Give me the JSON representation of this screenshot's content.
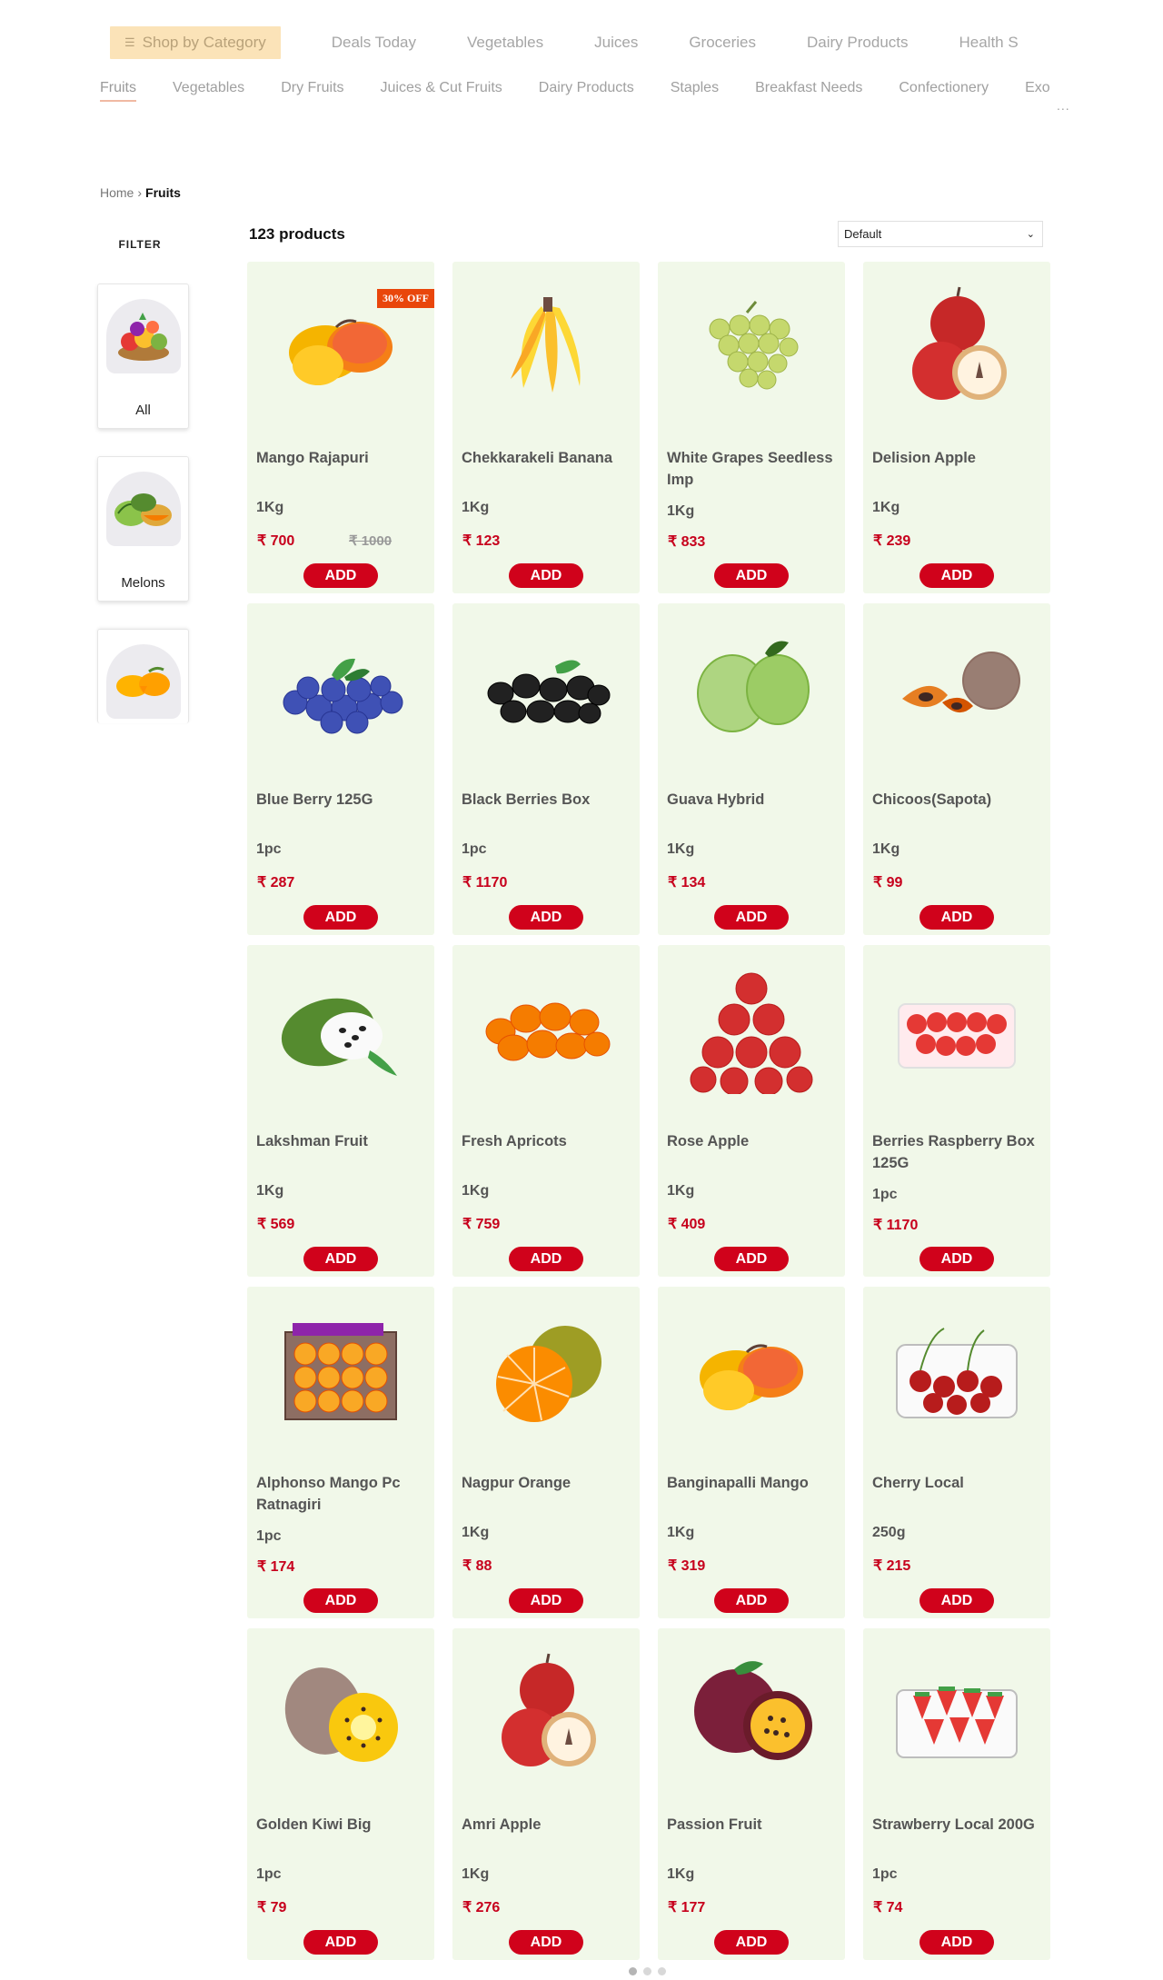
{
  "topnav": {
    "shop_label": "Shop by Category",
    "links": [
      "Deals Today",
      "Vegetables",
      "Juices",
      "Groceries",
      "Dairy Products",
      "Health S"
    ]
  },
  "subnav": {
    "links": [
      "Fruits",
      "Vegetables",
      "Dry Fruits",
      "Juices & Cut Fruits",
      "Dairy Products",
      "Staples",
      "Breakfast Needs",
      "Confectionery",
      "Exo"
    ],
    "more": "..."
  },
  "breadcrumb": {
    "home": "Home",
    "sep": "›",
    "current": "Fruits"
  },
  "filter": {
    "title": "FILTER",
    "categories": [
      {
        "label": "All",
        "icon": "fruit-basket-icon"
      },
      {
        "label": "Melons",
        "icon": "melons-icon"
      },
      {
        "label": "",
        "icon": "mango-icon"
      }
    ]
  },
  "products_count": "123 products",
  "sort": {
    "selected": "Default"
  },
  "add_label": "ADD",
  "products": [
    {
      "name": "Mango Rajapuri",
      "qty": "1Kg",
      "price": "₹ 700",
      "mrp": "₹ 1000",
      "badge": "30% OFF",
      "icon": "mango-icon"
    },
    {
      "name": "Chekkarakeli Banana",
      "qty": "1Kg",
      "price": "₹ 123",
      "icon": "banana-icon"
    },
    {
      "name": "White Grapes Seedless Imp",
      "qty": "1Kg",
      "price": "₹ 833",
      "icon": "grapes-icon"
    },
    {
      "name": "Delision Apple",
      "qty": "1Kg",
      "price": "₹ 239",
      "icon": "apple-icon"
    },
    {
      "name": "Blue Berry 125G",
      "qty": "1pc",
      "price": "₹ 287",
      "icon": "blueberry-icon"
    },
    {
      "name": "Black Berries Box",
      "qty": "1pc",
      "price": "₹ 1170",
      "icon": "blackberry-icon"
    },
    {
      "name": "Guava Hybrid",
      "qty": "1Kg",
      "price": "₹ 134",
      "icon": "guava-icon"
    },
    {
      "name": "Chicoos(Sapota)",
      "qty": "1Kg",
      "price": "₹ 99",
      "icon": "sapota-icon"
    },
    {
      "name": "Lakshman Fruit",
      "qty": "1Kg",
      "price": "₹ 569",
      "icon": "soursop-icon"
    },
    {
      "name": "Fresh Apricots",
      "qty": "1Kg",
      "price": "₹ 759",
      "icon": "apricot-icon"
    },
    {
      "name": "Rose Apple",
      "qty": "1Kg",
      "price": "₹ 409",
      "icon": "rose-apple-icon"
    },
    {
      "name": "Berries Raspberry Box 125G",
      "qty": "1pc",
      "price": "₹ 1170",
      "icon": "raspberry-icon"
    },
    {
      "name": "Alphonso Mango Pc Ratnagiri",
      "qty": "1pc",
      "price": "₹ 174",
      "icon": "mango-box-icon"
    },
    {
      "name": "Nagpur Orange",
      "qty": "1Kg",
      "price": "₹ 88",
      "icon": "orange-icon"
    },
    {
      "name": "Banginapalli Mango",
      "qty": "1Kg",
      "price": "₹ 319",
      "icon": "mango-icon"
    },
    {
      "name": "Cherry Local",
      "qty": "250g",
      "price": "₹ 215",
      "icon": "cherry-icon"
    },
    {
      "name": "Golden Kiwi Big",
      "qty": "1pc",
      "price": "₹ 79",
      "icon": "kiwi-icon"
    },
    {
      "name": "Amri Apple",
      "qty": "1Kg",
      "price": "₹ 276",
      "icon": "apple-icon"
    },
    {
      "name": "Passion Fruit",
      "qty": "1Kg",
      "price": "₹ 177",
      "icon": "passion-fruit-icon"
    },
    {
      "name": "Strawberry Local 200G",
      "qty": "1pc",
      "price": "₹ 74",
      "icon": "strawberry-icon"
    }
  ],
  "pagination": {
    "pages": 3,
    "active": 0
  },
  "colors": {
    "accent": "#d0021b",
    "card_bg": "#f1f8e9",
    "badge": "#e9460b",
    "shop_btn": "#fbe3b8"
  }
}
